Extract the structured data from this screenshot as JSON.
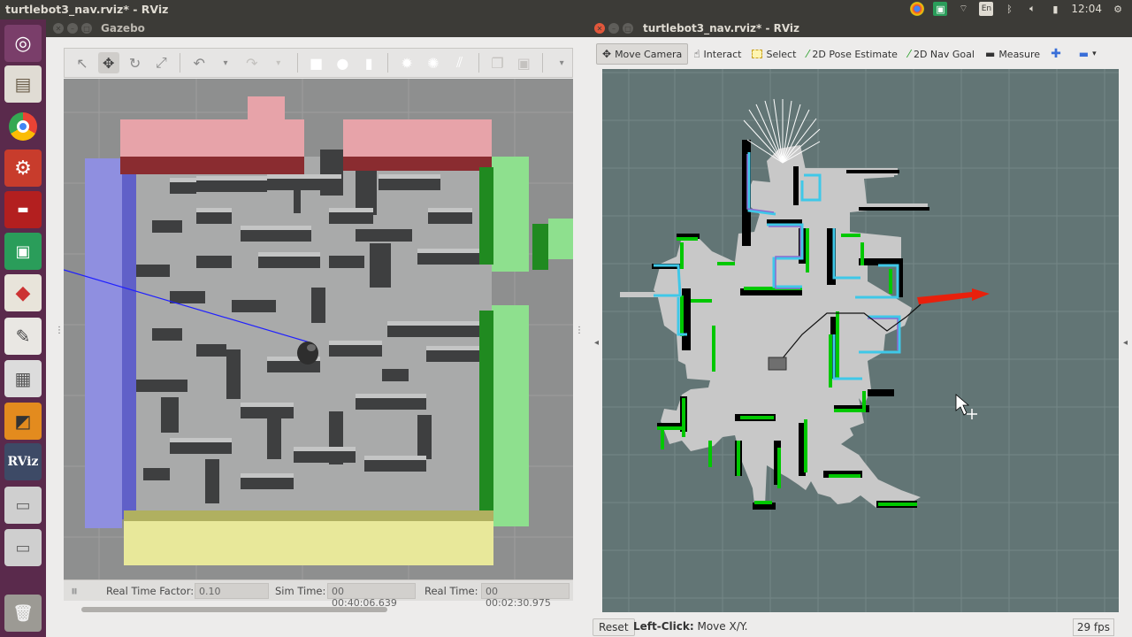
{
  "topbar": {
    "title": "turtlebot3_nav.rviz* - RViz",
    "lang": "En",
    "time": "12:04",
    "icons": [
      "chrome-icon",
      "camera-icon",
      "wifi-icon",
      "keyboard-icon",
      "bluetooth-icon",
      "speaker-icon",
      "battery-icon",
      "gear-icon"
    ]
  },
  "launcher": {
    "items": [
      "dash-icon",
      "files-icon",
      "chrome-icon",
      "settings-icon",
      "terminal-icon",
      "camera-icon",
      "geometry-icon",
      "editor-icon",
      "calculator-icon",
      "gazebo-icon",
      "rviz-icon",
      "disk-icon",
      "disk-icon",
      "trash-icon"
    ],
    "rviz_label": "RViz"
  },
  "gazebo": {
    "title": "Gazebo",
    "status": {
      "pause_glyph": "⏸",
      "rtf_label": "Real Time Factor:",
      "rtf_value": "0.10",
      "sim_label": "Sim Time:",
      "sim_value": "00 00:40:06.639",
      "real_label": "Real Time:",
      "real_value": "00 00:02:30.975"
    }
  },
  "rviz": {
    "title": "turtlebot3_nav.rviz* - RViz",
    "tools": [
      {
        "label": "Move Camera",
        "icon": "move-camera-icon",
        "active": true
      },
      {
        "label": "Interact",
        "icon": "interact-icon",
        "active": false
      },
      {
        "label": "Select",
        "icon": "select-icon",
        "active": false
      },
      {
        "label": "2D Pose Estimate",
        "icon": "pose-estimate-icon",
        "active": false
      },
      {
        "label": "2D Nav Goal",
        "icon": "nav-goal-icon",
        "active": false
      },
      {
        "label": "Measure",
        "icon": "measure-icon",
        "active": false
      }
    ],
    "status": {
      "reset": "Reset",
      "hint_bold": "Left-Click:",
      "hint_text": "Move X/Y.",
      "fps": "29 fps"
    }
  },
  "colors": {
    "launcher_bg": "#5a2a4c",
    "rviz_bg": "#627575",
    "map_free": "#c8c8c8",
    "scan_green": "#00c800",
    "costmap_cyan": "#3fc8e8",
    "goal_arrow": "#e8200c"
  }
}
